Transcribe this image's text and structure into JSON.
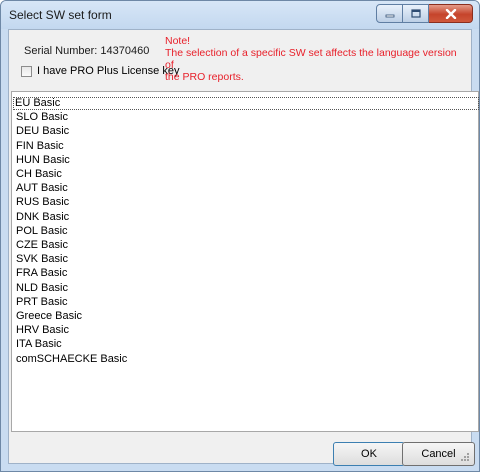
{
  "window": {
    "title": "Select SW set form"
  },
  "serial": {
    "text": "Serial Number: 14370460"
  },
  "license": {
    "label": "I have PRO Plus License key",
    "checked": false
  },
  "note": {
    "heading": "Note!",
    "line1": "The selection of a specific SW set affects the language version of",
    "line2": "the PRO reports."
  },
  "sw_sets": [
    {
      "label": "EU Basic",
      "selected": true
    },
    {
      "label": "SLO Basic"
    },
    {
      "label": "DEU Basic"
    },
    {
      "label": "FIN Basic"
    },
    {
      "label": "HUN Basic"
    },
    {
      "label": "CH Basic"
    },
    {
      "label": "AUT Basic"
    },
    {
      "label": "RUS Basic"
    },
    {
      "label": "DNK Basic"
    },
    {
      "label": "POL Basic"
    },
    {
      "label": "CZE Basic"
    },
    {
      "label": "SVK Basic"
    },
    {
      "label": "FRA Basic"
    },
    {
      "label": "NLD Basic"
    },
    {
      "label": "PRT Basic"
    },
    {
      "label": "Greece Basic"
    },
    {
      "label": "HRV Basic"
    },
    {
      "label": "ITA Basic"
    },
    {
      "label": "comSCHAECKE Basic"
    }
  ],
  "buttons": {
    "ok": "OK",
    "cancel": "Cancel"
  },
  "icons": {
    "minimize": "minimize-icon",
    "maximize": "maximize-icon",
    "close": "close-icon"
  },
  "colors": {
    "note_text": "#e8202a",
    "frame": "#c9dcf1",
    "close_button": "#c5442b"
  }
}
